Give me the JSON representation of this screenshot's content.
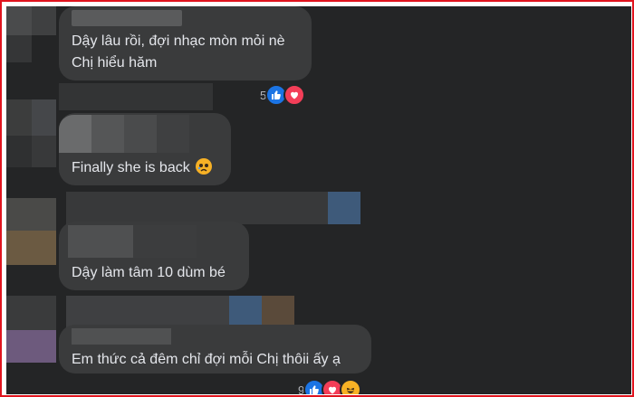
{
  "comments": [
    {
      "text_line1": "Dậy lâu rồi, đợi nhạc mòn mỏi nè",
      "text_line2": "Chị hiểu hăm",
      "reaction_count": "5"
    },
    {
      "text": "Finally she is back"
    },
    {
      "text": "Dậy làm tâm 10 dùm bé"
    },
    {
      "text": "Em thức cả đêm chỉ đợi mỗi Chị thôii ấy ạ",
      "reaction_count": "9"
    }
  ],
  "colors": {
    "background": "#242526",
    "bubble": "#3a3b3c",
    "text": "#e4e6eb",
    "meta": "#b0b3b8",
    "like": "#1b74e4",
    "love": "#f33e58",
    "haha": "#f7b125",
    "border": "#e0141e"
  },
  "icons": [
    "like-icon",
    "love-icon",
    "haha-icon",
    "sad-face-emoji"
  ]
}
